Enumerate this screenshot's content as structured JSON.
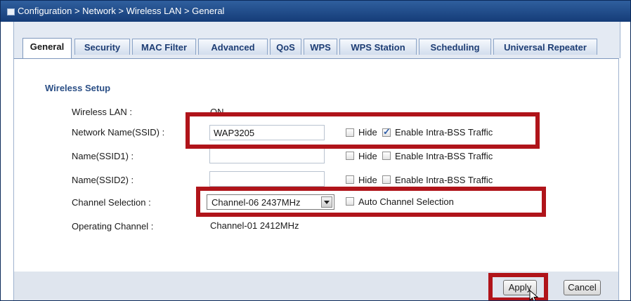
{
  "breadcrumb": "Configuration > Network > Wireless LAN > General",
  "tabs": [
    {
      "label": "General",
      "active": true
    },
    {
      "label": "Security"
    },
    {
      "label": "MAC Filter"
    },
    {
      "label": "Advanced"
    },
    {
      "label": "QoS"
    },
    {
      "label": "WPS"
    },
    {
      "label": "WPS Station"
    },
    {
      "label": "Scheduling"
    },
    {
      "label": "Universal Repeater"
    }
  ],
  "section": {
    "title": "Wireless Setup"
  },
  "form": {
    "wireless_lan": {
      "label": "Wireless LAN :",
      "value": "ON"
    },
    "ssid": {
      "label": "Network Name(SSID) :",
      "value": "WAP3205",
      "hide_label": "Hide",
      "hide_checked": false,
      "intra_label": "Enable Intra-BSS Traffic",
      "intra_checked": true
    },
    "ssid1": {
      "label": "Name(SSID1) :",
      "value": "",
      "hide_label": "Hide",
      "hide_checked": false,
      "intra_label": "Enable Intra-BSS Traffic",
      "intra_checked": false
    },
    "ssid2": {
      "label": "Name(SSID2) :",
      "value": "",
      "hide_label": "Hide",
      "hide_checked": false,
      "intra_label": "Enable Intra-BSS Traffic",
      "intra_checked": false
    },
    "channel": {
      "label": "Channel Selection :",
      "value": "Channel-06 2437MHz",
      "auto_label": "Auto Channel Selection",
      "auto_checked": false
    },
    "operating_channel": {
      "label": "Operating Channel :",
      "value": "Channel-01 2412MHz"
    }
  },
  "buttons": {
    "apply": "Apply",
    "cancel": "Cancel"
  },
  "colors": {
    "highlight": "#b0141a",
    "titlebar": "#1f4a8a",
    "section_title": "#2b4f86"
  }
}
